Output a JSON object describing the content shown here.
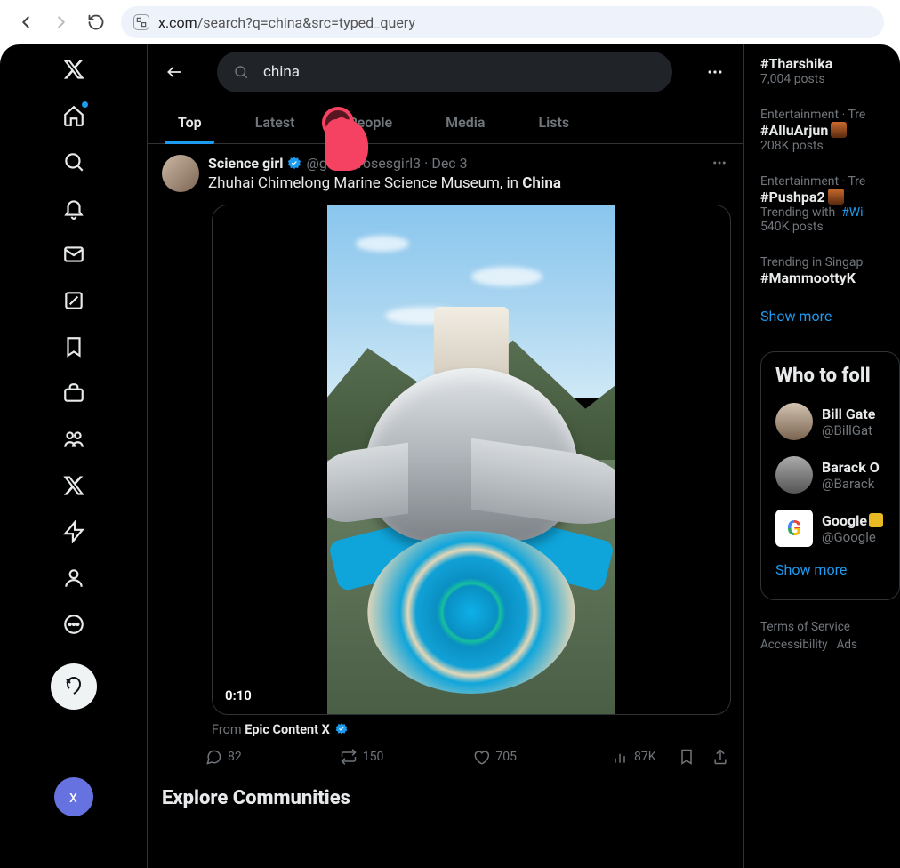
{
  "browser": {
    "url_host": "x.com",
    "url_path": "/search?q=china&src=typed_query"
  },
  "search": {
    "query": "china"
  },
  "tabs": [
    "Top",
    "Latest",
    "People",
    "Media",
    "Lists"
  ],
  "post": {
    "display_name": "Science girl",
    "handle": "@gunsnrosesgirl3",
    "date": "Dec 3",
    "text_prefix": "Zhuhai Chimelong Marine Science Museum, in ",
    "text_bold": "China",
    "video_duration": "0:10",
    "from_label": "From ",
    "from_name": "Epic Content X",
    "actions": {
      "replies": "82",
      "reposts": "150",
      "likes": "705",
      "views": "87K"
    }
  },
  "explore_heading": "Explore Communities",
  "trends": [
    {
      "hashtag": "#Tharshika",
      "meta": "7,004 posts",
      "context": ""
    },
    {
      "hashtag": "#AlluArjun",
      "meta": "208K posts",
      "context": "Entertainment · Tre",
      "thumb": true
    },
    {
      "hashtag": "#Pushpa2",
      "meta": "540K posts",
      "context": "Entertainment · Tre",
      "thumb": true,
      "trending_with": "#Wi"
    },
    {
      "hashtag": "#MammoottyK",
      "meta": "",
      "context": "Trending in Singap"
    }
  ],
  "show_more": "Show more",
  "who_to_follow": {
    "title": "Who to foll",
    "items": [
      {
        "name": "Bill Gate",
        "handle": "@BillGat"
      },
      {
        "name": "Barack O",
        "handle": "@Barack"
      },
      {
        "name": "Google",
        "handle": "@Google",
        "gold": true
      }
    ]
  },
  "footer": {
    "tos": "Terms of Service",
    "a11y": "Accessibility",
    "ads": "Ads"
  },
  "profile_initial": "x"
}
